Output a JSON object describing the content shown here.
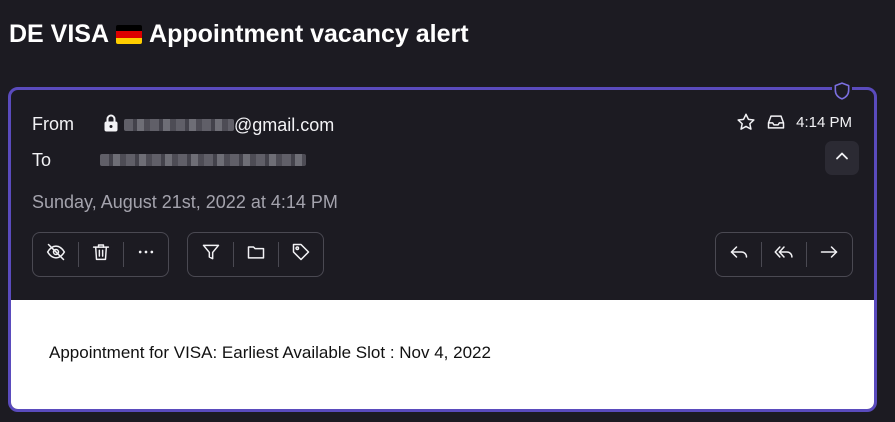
{
  "email": {
    "subject_prefix": "DE VISA",
    "subject_suffix": "Appointment vacancy alert",
    "from_label": "From",
    "from_domain": "@gmail.com",
    "to_label": "To",
    "date": "Sunday, August 21st, 2022 at 4:14 PM",
    "time": "4:14 PM",
    "body": "Appointment for VISA: Earliest Available Slot : Nov 4, 2022"
  },
  "colors": {
    "accent": "#5a4bbd",
    "background": "#1c1b22",
    "flag_black": "#000000",
    "flag_red": "#dd0000",
    "flag_gold": "#ffce00"
  }
}
